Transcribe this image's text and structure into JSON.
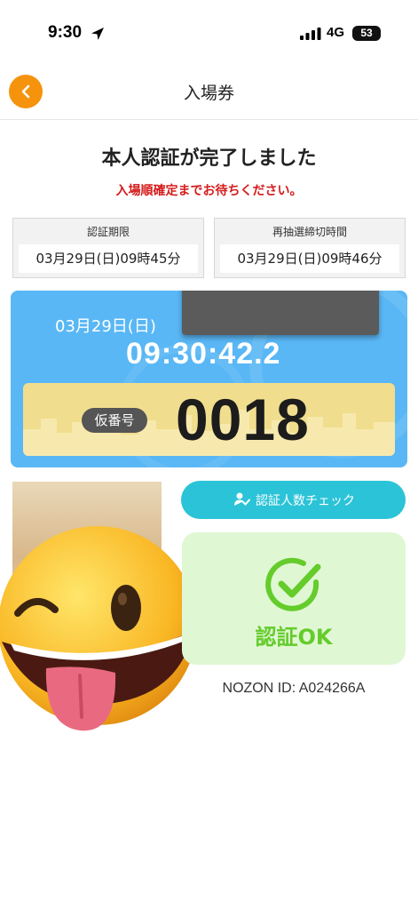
{
  "status_bar": {
    "time": "9:30",
    "network": "4G",
    "battery": "53",
    "location_icon": "location-arrow-icon",
    "signal_icon": "signal-bars-icon"
  },
  "nav": {
    "title": "入場券",
    "back_icon": "chevron-left-icon",
    "back_color": "#f5930d"
  },
  "main": {
    "title": "本人認証が完了しました",
    "subtitle": "入場順確定までお待ちください。",
    "subtitle_color": "#d51b1b"
  },
  "info": {
    "auth_limit_label": "認証期限",
    "auth_limit_value": "03月29日(日)09時45分",
    "redraw_label": "再抽選締切時間",
    "redraw_value": "03月29日(日)09時46分"
  },
  "ticket": {
    "date": "03月29日(日)",
    "clock": "09:30:42.2",
    "number_label": "仮番号",
    "number": "0018",
    "bg_color": "#59b7f5",
    "band_color": "#f0de8e"
  },
  "actions": {
    "check_label": "認証人数チェック",
    "check_icon": "person-check-icon",
    "check_color": "#2bc3d7"
  },
  "status": {
    "ok_label": "認証OK",
    "ok_icon": "check-circle-icon",
    "ok_color": "#64cc2b"
  },
  "footer": {
    "nozon_id": "NOZON ID: A024266A"
  },
  "overlay": {
    "emoji_icon": "winking-face-with-tongue-icon"
  }
}
